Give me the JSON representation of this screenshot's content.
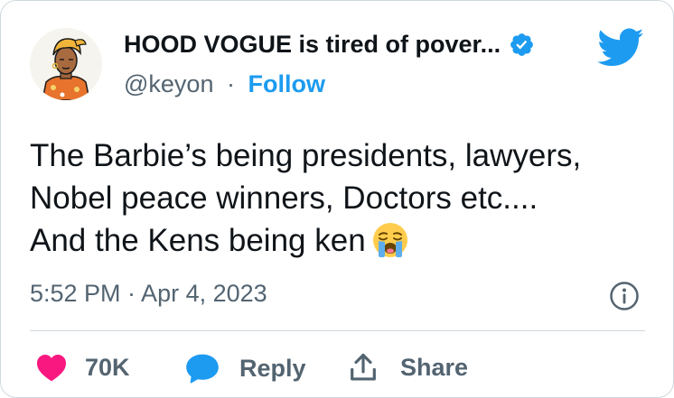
{
  "author": {
    "display_name": "HOOD VOGUE is tired of pover...",
    "handle": "@keyon",
    "separator": "·",
    "follow_label": "Follow"
  },
  "tweet": {
    "lines": [
      "The Barbie’s being presidents, lawyers,",
      "Nobel peace winners, Doctors etc....",
      "And the Kens being ken"
    ],
    "emoji": "loudly-crying-face",
    "timestamp": "5:52 PM · Apr 4, 2023"
  },
  "actions": {
    "like_count": "70K",
    "reply_label": "Reply",
    "share_label": "Share"
  },
  "colors": {
    "text": "#0f1419",
    "secondary": "#536471",
    "accent": "#1d9bf0",
    "like": "#f91880",
    "border": "#cfd9de"
  }
}
